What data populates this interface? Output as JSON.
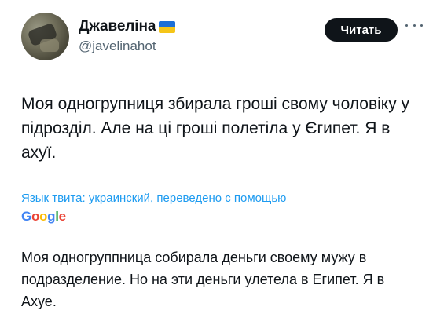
{
  "author": {
    "display_name": "Джавеліна",
    "handle": "@javelinahot",
    "flag_icon": "ukraine-flag-icon"
  },
  "actions": {
    "follow_label": "Читать",
    "more_icon": "more-horizontal-icon"
  },
  "tweet": {
    "original_text": "Моя одногрупниця збирала гроші свому чоловіку у підрозділ. Але на ці гроші полетіла у Єгипет. Я в ахуї.",
    "translation_label": "Язык твита: украинский, переведено с помощью",
    "translation_provider": "Google",
    "translated_text": "Моя одногруппница собирала деньги своему мужу в подразделение. Но на эти деньги улетела в Египет. Я в Ахуе."
  },
  "colors": {
    "link": "#1d9bf0",
    "text": "#0f1419",
    "secondary": "#536471",
    "button_bg": "#0f1419"
  }
}
